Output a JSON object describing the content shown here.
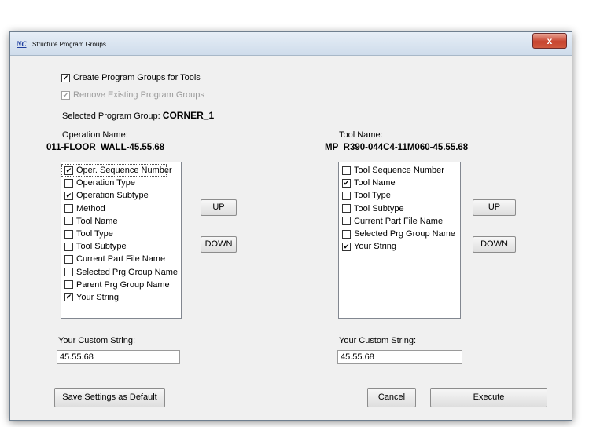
{
  "window": {
    "title": "Structure Program Groups",
    "app_icon": "NC",
    "close_label": "x"
  },
  "options": {
    "create_groups": {
      "label": "Create Program Groups for Tools",
      "checked": true
    },
    "remove_existing": {
      "label": "Remove Existing Program Groups",
      "checked": true
    }
  },
  "selected_group": {
    "label": "Selected Program Group:",
    "value": "CORNER_1"
  },
  "operation": {
    "label": "Operation Name:",
    "value": "011-FLOOR_WALL-45.55.68",
    "items": [
      {
        "label": "Oper. Sequence Number",
        "checked": true
      },
      {
        "label": "Operation Type",
        "checked": false
      },
      {
        "label": "Operation Subtype",
        "checked": true
      },
      {
        "label": "Method",
        "checked": false
      },
      {
        "label": "Tool Name",
        "checked": false
      },
      {
        "label": "Tool Type",
        "checked": false
      },
      {
        "label": "Tool Subtype",
        "checked": false
      },
      {
        "label": "Current Part File Name",
        "checked": false
      },
      {
        "label": "Selected Prg Group Name",
        "checked": false
      },
      {
        "label": "Parent Prg Group Name",
        "checked": false
      },
      {
        "label": "Your String",
        "checked": true
      }
    ],
    "up_label": "UP",
    "down_label": "DOWN",
    "custom_label": "Your Custom String:",
    "custom_value": "45.55.68"
  },
  "tool": {
    "label": "Tool Name:",
    "value": "MP_R390-044C4-11M060-45.55.68",
    "items": [
      {
        "label": "Tool Sequence Number",
        "checked": false
      },
      {
        "label": "Tool Name",
        "checked": true
      },
      {
        "label": "Tool Type",
        "checked": false
      },
      {
        "label": "Tool Subtype",
        "checked": false
      },
      {
        "label": "Current Part File Name",
        "checked": false
      },
      {
        "label": "Selected Prg Group Name",
        "checked": false
      },
      {
        "label": "Your String",
        "checked": true
      }
    ],
    "up_label": "UP",
    "down_label": "DOWN",
    "custom_label": "Your Custom String:",
    "custom_value": "45.55.68"
  },
  "footer": {
    "save_label": "Save Settings as Default",
    "cancel_label": "Cancel",
    "execute_label": "Execute"
  }
}
